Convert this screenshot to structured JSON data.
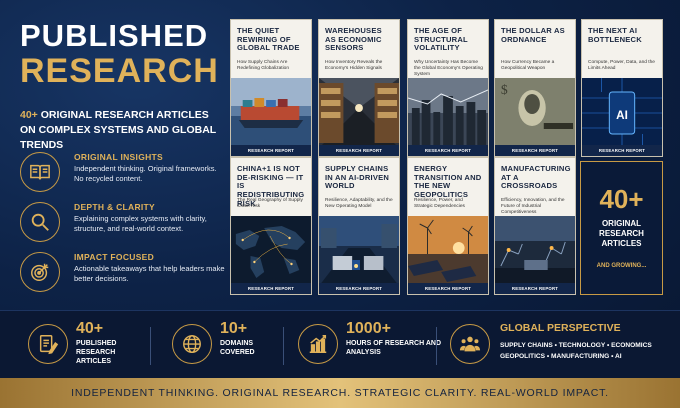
{
  "header": {
    "title_line1": "PUBLISHED",
    "title_line2": "RESEARCH",
    "subtitle_highlight": "40+",
    "subtitle_rest": " ORIGINAL RESEARCH ARTICLES",
    "subtitle_line2": "ON COMPLEX SYSTEMS AND GLOBAL TRENDS"
  },
  "features": [
    {
      "icon": "open-book-icon",
      "title": "ORIGINAL INSIGHTS",
      "desc": "Independent thinking. Original frameworks. No recycled content."
    },
    {
      "icon": "magnifier-icon",
      "title": "DEPTH & CLARITY",
      "desc": "Explaining complex systems with clarity, structure, and real-world context."
    },
    {
      "icon": "target-icon",
      "title": "IMPACT FOCUSED",
      "desc": "Actionable takeaways that help leaders make better decisions."
    }
  ],
  "cards": [
    {
      "title": "THE QUIET REWIRING OF GLOBAL TRADE",
      "sub": "How Supply Chains Are Redefining Globalization",
      "badge": "RESEARCH REPORT",
      "scene": "port"
    },
    {
      "title": "WAREHOUSES AS ECONOMIC SENSORS",
      "sub": "How Inventory Reveals the Economy's Hidden Signals",
      "badge": "RESEARCH REPORT",
      "scene": "warehouse"
    },
    {
      "title": "THE AGE OF STRUCTURAL VOLATILITY",
      "sub": "Why Uncertainty Has Become the Global Economy's Operating System",
      "badge": "RESEARCH REPORT",
      "scene": "city"
    },
    {
      "title": "THE DOLLAR AS ORDNANCE",
      "sub": "How Currency Became a Geopolitical Weapon",
      "badge": "RESEARCH REPORT",
      "scene": "dollar"
    },
    {
      "title": "THE NEXT AI BOTTLENECK",
      "sub": "Compute, Power, Data, and the Limits Ahead",
      "badge": "RESEARCH REPORT",
      "scene": "ai"
    },
    {
      "title": "CHINA+1 IS NOT DE-RISKING — IT IS REDISTRIBUTING RISK",
      "sub": "The Real Geography of Supply Chain Risk",
      "badge": "RESEARCH REPORT",
      "scene": "map"
    },
    {
      "title": "SUPPLY CHAINS IN AN AI-DRIVEN WORLD",
      "sub": "Resilience, Adaptability, and the New Operating Model",
      "badge": "RESEARCH REPORT",
      "scene": "trucks"
    },
    {
      "title": "ENERGY TRANSITION AND THE NEW GEOPOLITICS",
      "sub": "Resilience, Power, and Strategic Dependencies",
      "badge": "RESEARCH REPORT",
      "scene": "energy"
    },
    {
      "title": "MANUFACTURING AT A CROSSROADS",
      "sub": "Efficiency, Innovation, and the Future of Industrial Competitiveness",
      "badge": "RESEARCH REPORT",
      "scene": "factory"
    }
  ],
  "counter": {
    "number": "40+",
    "label_lines": [
      "ORIGINAL",
      "RESEARCH",
      "ARTICLES"
    ],
    "growing": "AND GROWING..."
  },
  "stats": [
    {
      "icon": "document-pen-icon",
      "number": "40+",
      "label": "PUBLISHED RESEARCH ARTICLES"
    },
    {
      "icon": "globe-icon",
      "number": "10+",
      "label": "DOMAINS COVERED"
    },
    {
      "icon": "bar-chart-icon",
      "number": "1000+",
      "label": "HOURS OF RESEARCH AND ANALYSIS"
    }
  ],
  "global": {
    "icon": "people-icon",
    "title": "GLOBAL PERSPECTIVE",
    "line1": "SUPPLY CHAINS • TECHNOLOGY • ECONOMICS",
    "line2": "GEOPOLITICS • MANUFACTURING • AI"
  },
  "footer": {
    "tagline": "INDEPENDENT THINKING.  ORIGINAL RESEARCH.  STRATEGIC CLARITY.  REAL-WORLD IMPACT."
  },
  "colors": {
    "gold": "#e0b25a",
    "navy": "#0b1a33",
    "card": "#f4f2ec"
  }
}
